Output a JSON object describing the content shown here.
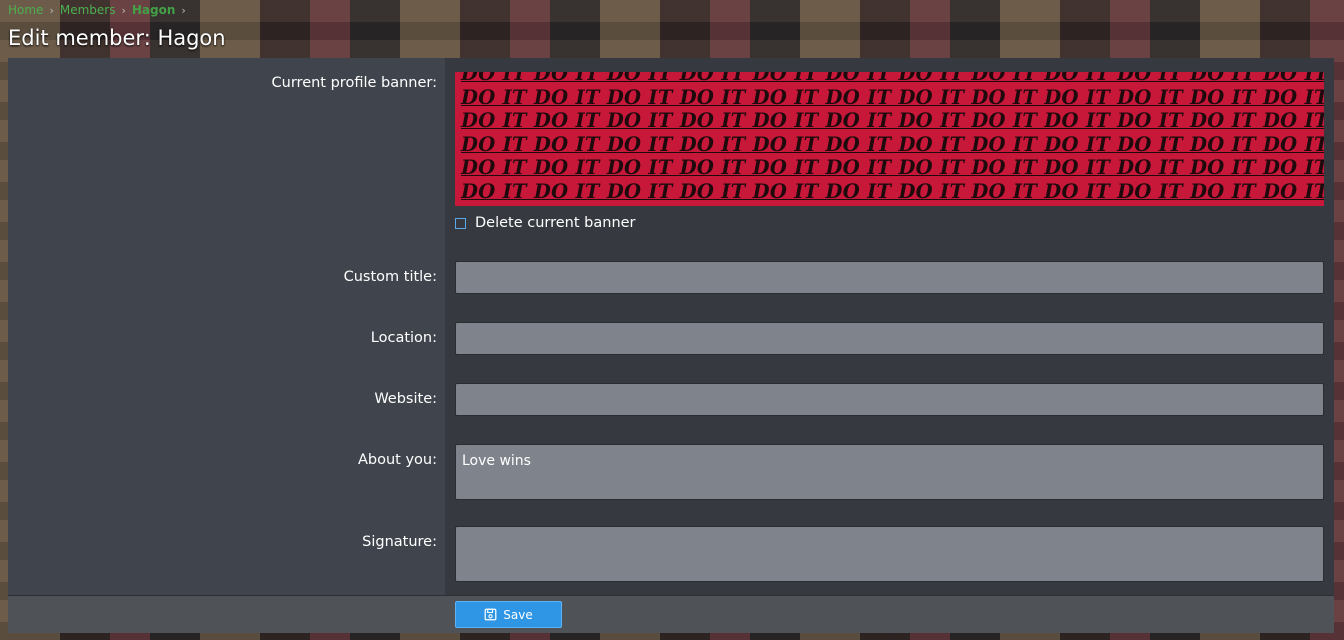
{
  "breadcrumb": {
    "items": [
      "Home",
      "Members",
      "Hagon"
    ]
  },
  "page": {
    "title": "Edit member: Hagon"
  },
  "form": {
    "banner_label": "Current profile banner:",
    "banner_text": "DO IT",
    "delete_banner_label": "Delete current banner",
    "custom_title": {
      "label": "Custom title:",
      "value": ""
    },
    "location": {
      "label": "Location:",
      "value": ""
    },
    "website": {
      "label": "Website:",
      "value": ""
    },
    "about": {
      "label": "About you:",
      "value": "Love wins"
    },
    "signature": {
      "label": "Signature:",
      "value": ""
    }
  },
  "footer": {
    "save_label": "Save"
  },
  "colors": {
    "banner": "#c8183a",
    "accent": "#2f96e6",
    "link": "#4caf50"
  },
  "icons": {
    "save": "floppy-disk-icon",
    "checkbox": "checkbox-unchecked"
  }
}
